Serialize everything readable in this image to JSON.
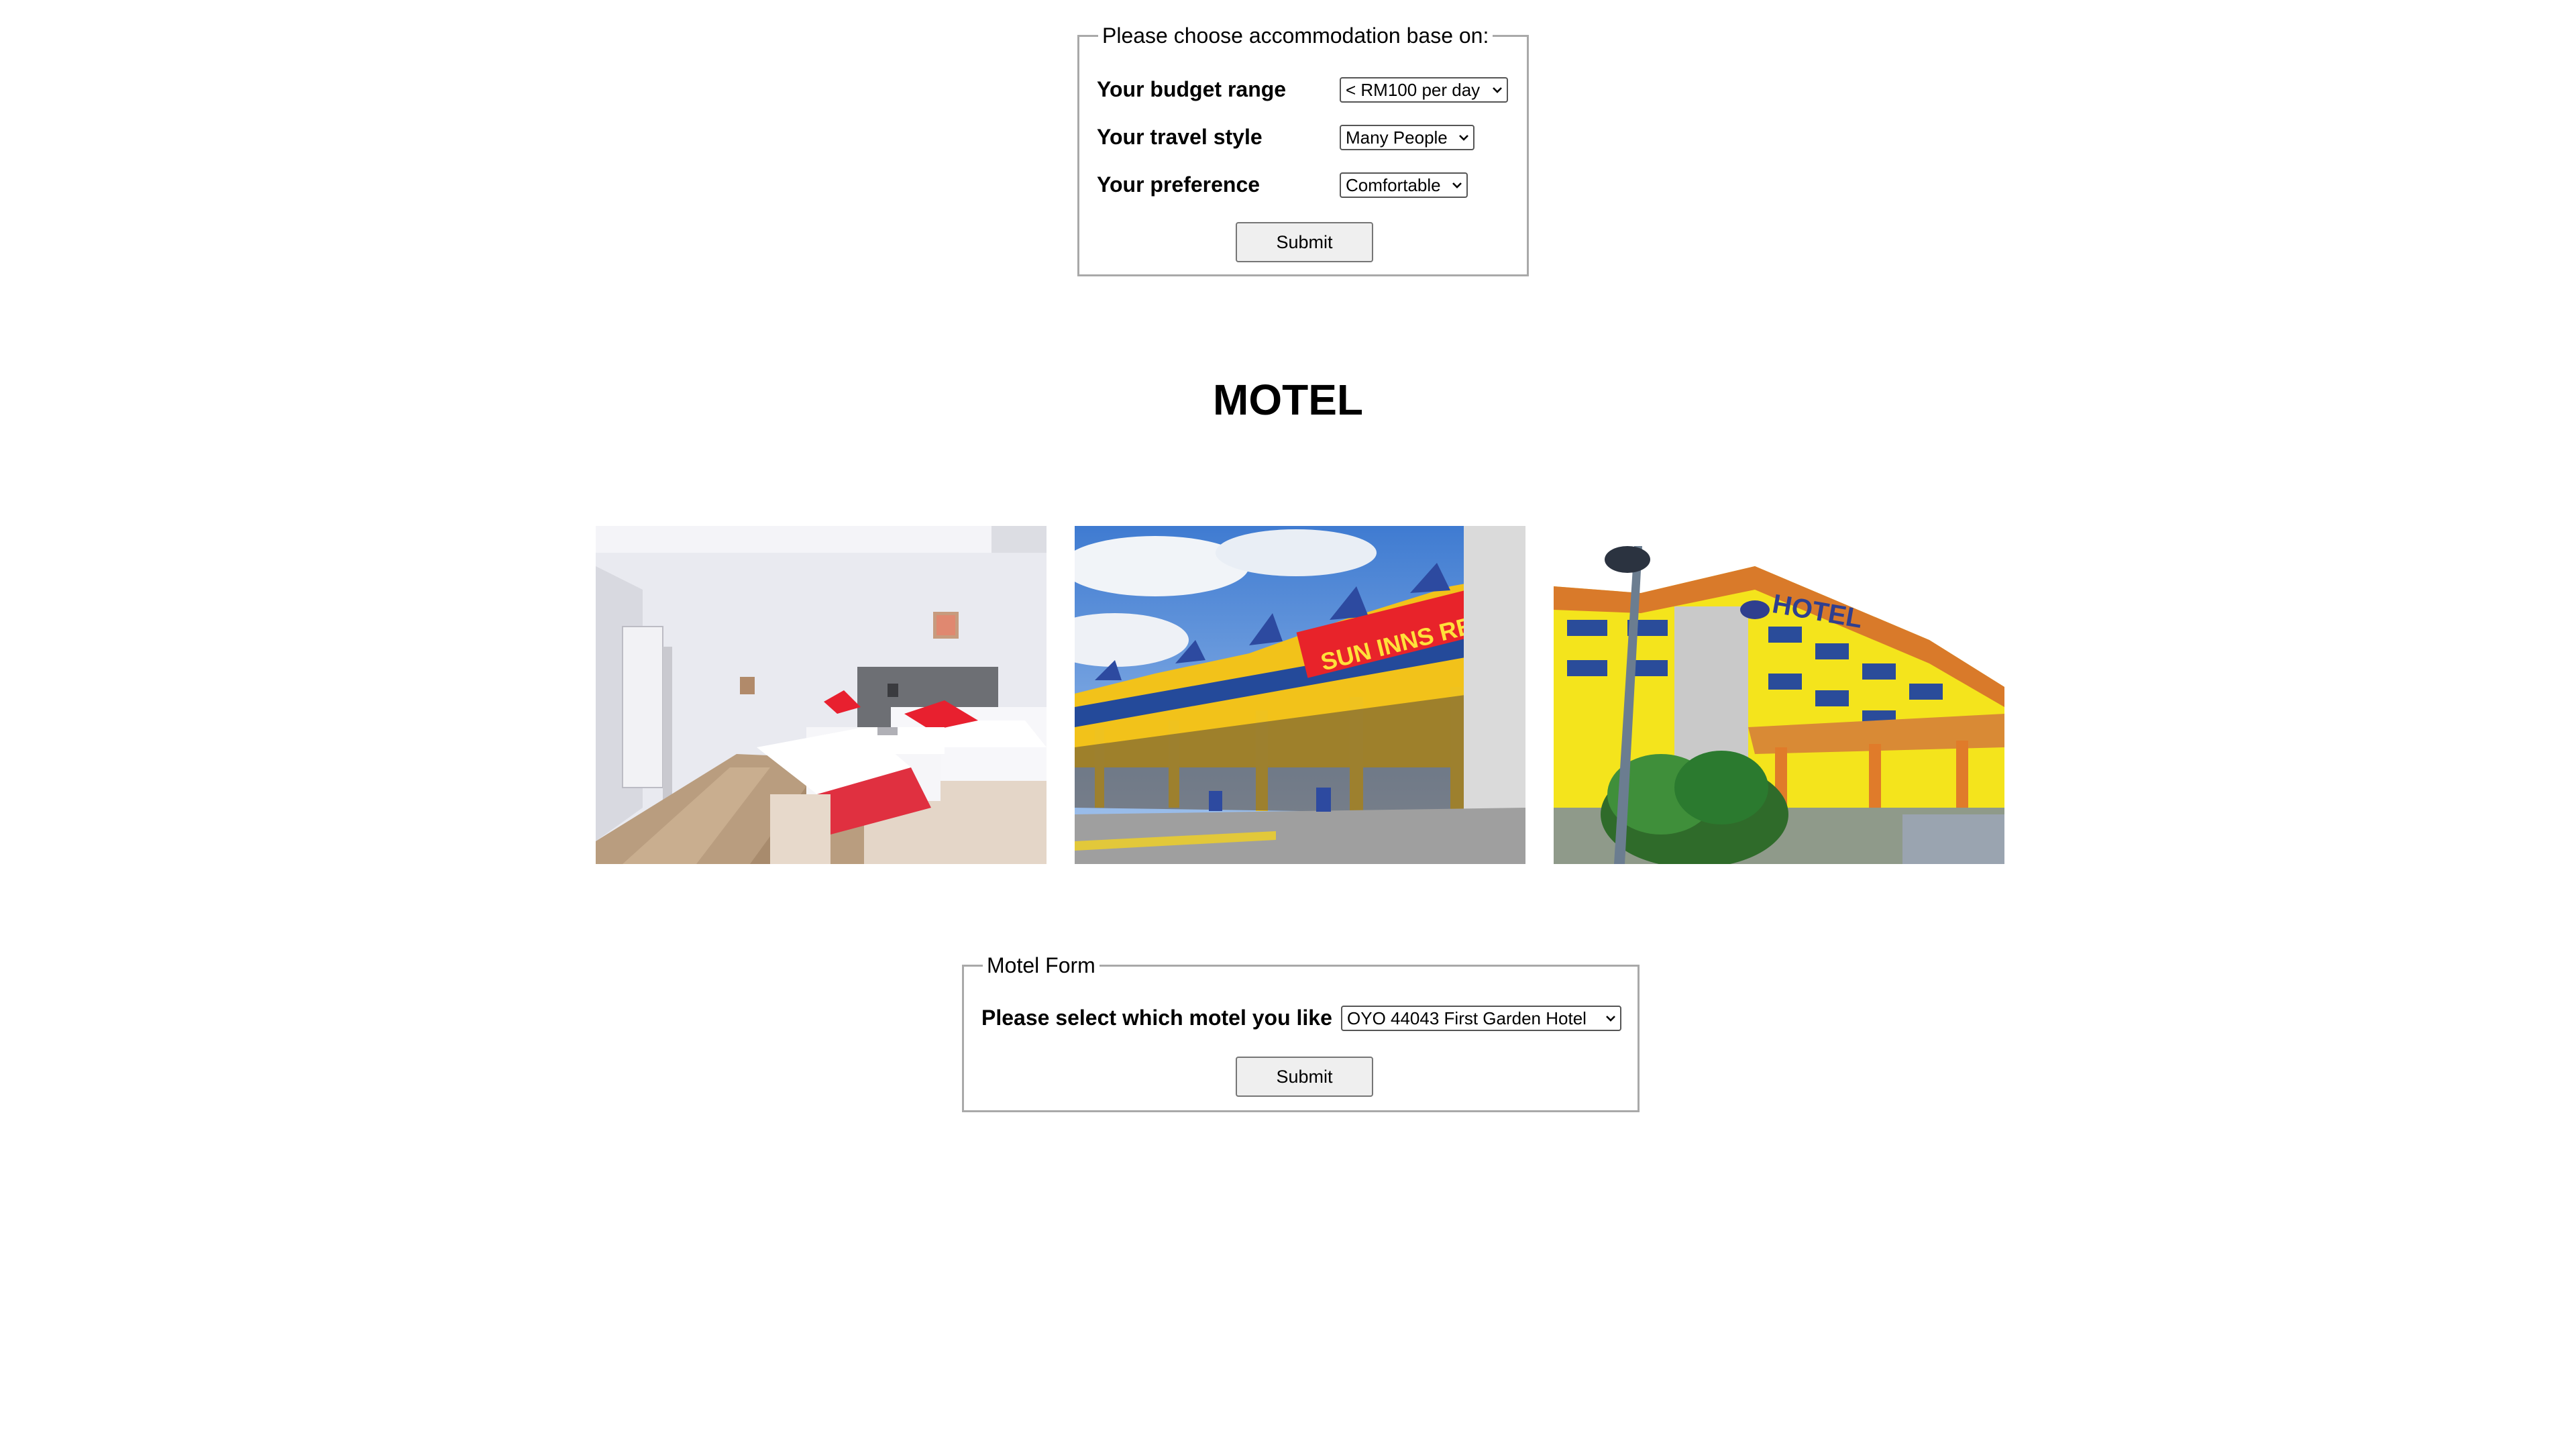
{
  "accommodation_form": {
    "legend": "Please choose accommodation base on:",
    "budget": {
      "label": "Your budget range",
      "selected": "< RM100 per day"
    },
    "travel_style": {
      "label": "Your travel style",
      "selected": "Many People"
    },
    "preference": {
      "label": "Your preference",
      "selected": "Comfortable"
    },
    "submit_label": "Submit"
  },
  "section_title": "MOTEL",
  "photos": {
    "photo1": {
      "icon": "hotel-room-photo"
    },
    "photo2": {
      "icon": "rest-house-photo",
      "sign_text": "SUN INNS REST HOUSE"
    },
    "photo3": {
      "icon": "hotel-building-photo",
      "sign_text": "HOTEL"
    }
  },
  "motel_form": {
    "legend": "Motel Form",
    "select_label": "Please select which motel you like",
    "selected": "OYO 44043 First Garden Hotel",
    "submit_label": "Submit"
  },
  "colors": {
    "border": "#a9a9a9",
    "button_bg": "#efefef",
    "text": "#000000"
  }
}
